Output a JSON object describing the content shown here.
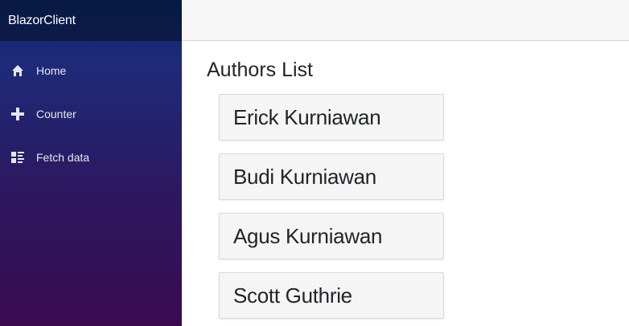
{
  "app": {
    "brand": "BlazorClient"
  },
  "sidebar": {
    "items": [
      {
        "label": "Home",
        "icon": "home-icon"
      },
      {
        "label": "Counter",
        "icon": "plus-icon"
      },
      {
        "label": "Fetch data",
        "icon": "list-rich-icon"
      }
    ]
  },
  "main": {
    "title": "Authors List",
    "authors": [
      "Erick Kurniawan",
      "Budi Kurniawan",
      "Agus Kurniawan",
      "Scott Guthrie"
    ]
  }
}
